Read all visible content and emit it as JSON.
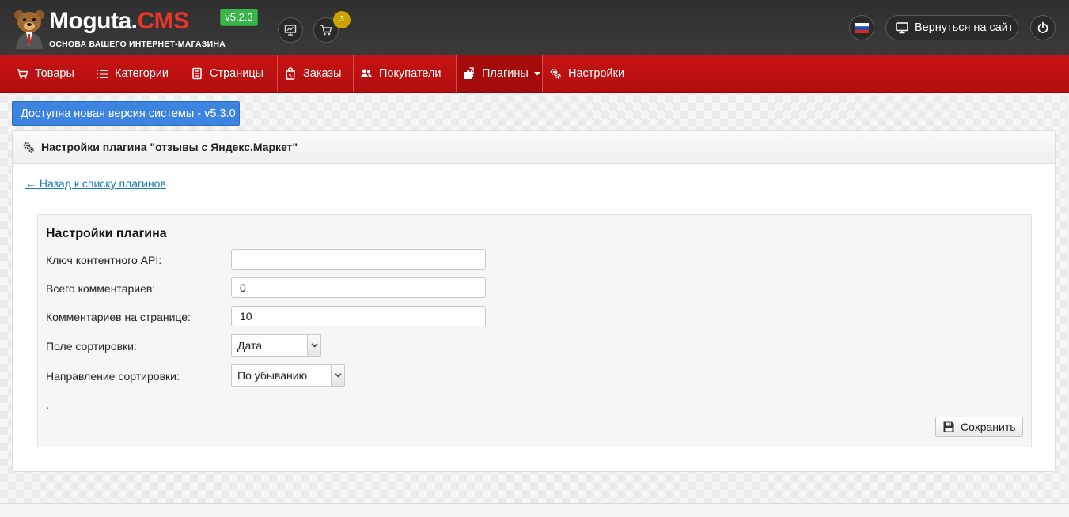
{
  "header": {
    "logo_main": "Moguta.",
    "logo_accent": "CMS",
    "logo_subtitle": "ОСНОВА ВАШЕГО ИНТЕРНЕТ-МАГАЗИНА",
    "version": "v5.2.3",
    "cart_count": "3",
    "return_label": "Вернуться на сайт",
    "colors": {
      "background": "#333333",
      "accent": "#e8352a",
      "version_badge": "#39b54a"
    }
  },
  "nav": {
    "items": [
      {
        "label": "Товары",
        "icon": "cart-icon"
      },
      {
        "label": "Категории",
        "icon": "list-icon"
      },
      {
        "label": "Страницы",
        "icon": "pages-icon"
      },
      {
        "label": "Заказы",
        "icon": "orders-icon"
      },
      {
        "label": "Покупатели",
        "icon": "users-icon"
      },
      {
        "label": "Плагины",
        "icon": "puzzle-icon"
      },
      {
        "label": "Настройки",
        "icon": "gears-icon"
      }
    ],
    "colors": {
      "background": "#c01010"
    }
  },
  "notice": {
    "label": "Доступна новая версия системы - v5.3.0"
  },
  "panel": {
    "title": "Настройки плагина \"отзывы с Яндекс.Маркет\"",
    "back_link": "← Назад к списку плагинов"
  },
  "settings": {
    "title": "Настройки плагина",
    "fields": [
      {
        "label": "Ключ контентного API:",
        "value": ""
      },
      {
        "label": "Всего комментариев:",
        "value": "0"
      },
      {
        "label": "Комментариев на странице:",
        "value": "10"
      }
    ],
    "sort_field": {
      "label": "Поле сортировки:",
      "value": "Дата"
    },
    "sort_direction": {
      "label": "Направление сортировки:",
      "value": "По убыванию"
    },
    "dot": ".",
    "save_label": "Сохранить"
  }
}
